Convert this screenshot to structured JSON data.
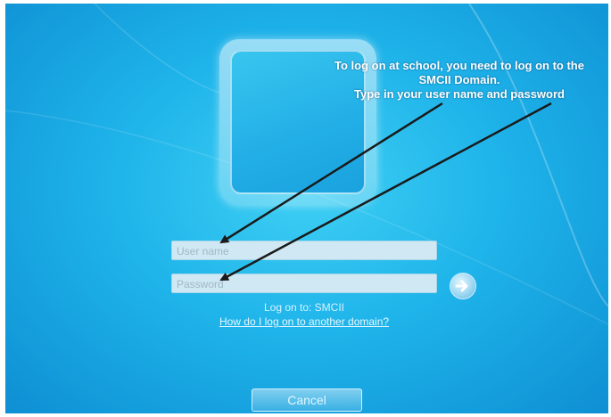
{
  "annotation": {
    "line1": "To log on at school, you need to log on to the",
    "line2": "SMCII Domain.",
    "line3": "Type in your user name and password"
  },
  "login": {
    "username_placeholder": "User name",
    "password_placeholder": "Password",
    "logon_to": "Log on to: SMCII",
    "other_domain_link": "How do I log on to another domain?",
    "cancel_label": "Cancel"
  },
  "icons": {
    "submit": "arrow-right-icon",
    "user_tile": "user-picture-frame"
  },
  "colors": {
    "background": "#1fb4ea",
    "annotation_text": "#ffffff",
    "arrow": "#1a1a1a"
  }
}
